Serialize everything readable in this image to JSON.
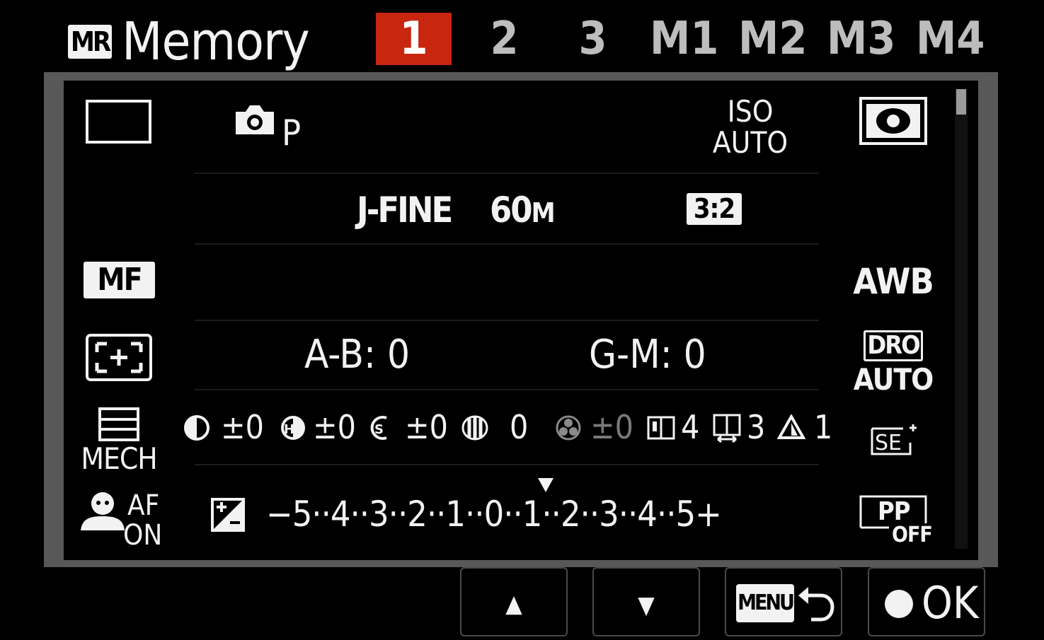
{
  "header": {
    "mr_badge": "MR",
    "title": "Memory",
    "tabs": [
      {
        "label": "1",
        "active": true
      },
      {
        "label": "2",
        "active": false
      },
      {
        "label": "3",
        "active": false
      },
      {
        "label": "M1",
        "active": false
      },
      {
        "label": "M2",
        "active": false
      },
      {
        "label": "M3",
        "active": false
      },
      {
        "label": "M4",
        "active": false
      }
    ]
  },
  "left": {
    "af_area_icon": "single-frame-icon",
    "focus_mode": "MF",
    "metering_icon": "focus-area-wide-icon",
    "shutter_type": "MECH",
    "face_af_label_1": "AF",
    "face_af_label_2": "ON"
  },
  "center": {
    "mode_letter": "P",
    "iso_line1": "ISO",
    "iso_line2": "AUTO",
    "quality": "J-FINE",
    "size_num": "60",
    "size_unit": "M",
    "aspect": "3:2",
    "wb_ab": "A-B: 0",
    "wb_gm": "G-M: 0",
    "creative_values": [
      {
        "icon": "contrast-icon",
        "value": "±0",
        "dim": false
      },
      {
        "icon": "highlight-icon",
        "value": "±0",
        "dim": false
      },
      {
        "icon": "shadow-icon",
        "value": "±0",
        "dim": false
      },
      {
        "icon": "fade-icon",
        "value": "0",
        "dim": false
      },
      {
        "icon": "saturation-icon",
        "value": "±0",
        "dim": true
      },
      {
        "icon": "sharpness-icon",
        "value": "4",
        "dim": false
      },
      {
        "icon": "sharpness-range-icon",
        "value": "3",
        "dim": false
      },
      {
        "icon": "clarity-icon",
        "value": "1",
        "dim": false
      }
    ],
    "ev_scale": "−5··4··3··2··1··0··1··2··3··4··5+"
  },
  "right": {
    "metering_icon": "metering-multi-icon",
    "wb": "AWB",
    "dro_line1": "DRO",
    "dro_line2": "AUTO",
    "scene_icon": "SE",
    "pp_line1": "PP",
    "pp_line2": "OFF"
  },
  "buttons": {
    "up": "▲",
    "down": "▼",
    "menu": "MENU",
    "ok": "OK"
  },
  "colors": {
    "active_tab": "#c8260f",
    "panel_frame": "#585858"
  }
}
